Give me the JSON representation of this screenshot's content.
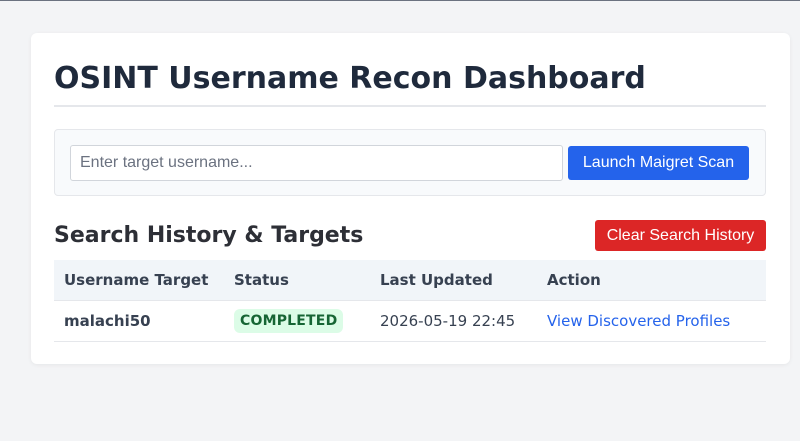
{
  "header": {
    "title": "OSINT Username Recon Dashboard"
  },
  "scan": {
    "input_placeholder": "Enter target username...",
    "input_value": "",
    "launch_label": "Launch Maigret Scan"
  },
  "history": {
    "title": "Search History & Targets",
    "clear_label": "Clear Search History",
    "columns": [
      "Username Target",
      "Status",
      "Last Updated",
      "Action"
    ],
    "rows": [
      {
        "username": "malachi50",
        "status": "COMPLETED",
        "last_updated": "2026-05-19 22:45",
        "action": "View Discovered Profiles"
      }
    ]
  },
  "colors": {
    "primary_button": "#2463eb",
    "danger_button": "#dc2626",
    "status_completed_bg": "#dcfce7",
    "status_completed_text": "#166534",
    "link": "#2563eb"
  }
}
